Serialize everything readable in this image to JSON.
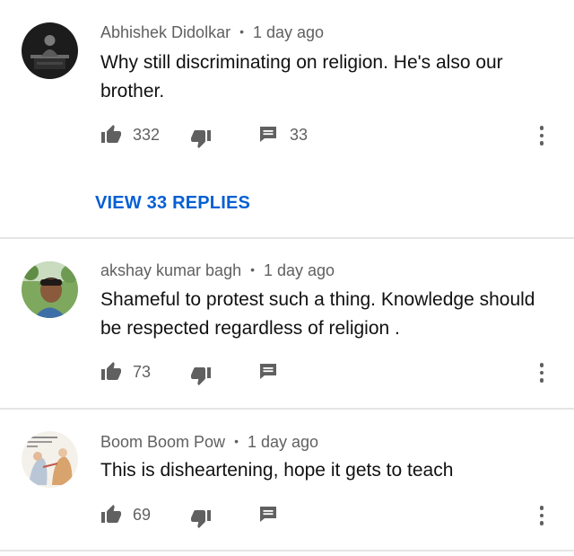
{
  "comments": [
    {
      "author": "Abhishek Didolkar",
      "separator": "•",
      "time": "1 day ago",
      "text": "Why still discriminating on religion. He's also our brother.",
      "likes": "332",
      "reply_count": "33",
      "view_replies": "VIEW 33 REPLIES"
    },
    {
      "author": "akshay kumar bagh",
      "separator": "•",
      "time": "1 day ago",
      "text": "Shameful to protest such a thing.  Knowledge should be respected regardless of religion .",
      "likes": "73"
    },
    {
      "author": "Boom Boom Pow",
      "separator": "•",
      "time": "1 day ago",
      "text": "This is disheartening, hope it gets to teach",
      "likes": "69"
    }
  ],
  "icons": {
    "like": "thumbs-up-icon",
    "dislike": "thumbs-down-icon",
    "reply": "comment-icon",
    "more": "more-vertical-icon"
  },
  "colors": {
    "accent": "#065fd4",
    "secondary_text": "#606060",
    "divider": "#e5e5e5"
  }
}
